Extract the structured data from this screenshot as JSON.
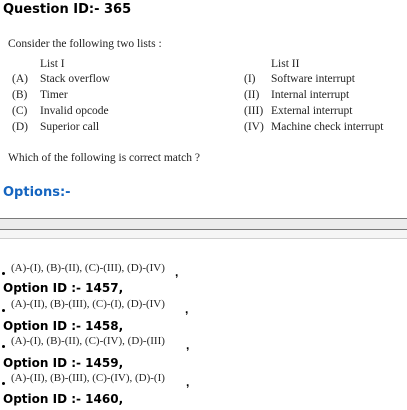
{
  "question": {
    "id_label": "Question ID:- 365",
    "statement": "Consider the following two lists :",
    "list1_title": "List I",
    "list2_title": "List II",
    "list1": [
      {
        "label": "(A)",
        "text": "Stack overflow"
      },
      {
        "label": "(B)",
        "text": "Timer"
      },
      {
        "label": "(C)",
        "text": "Invalid opcode"
      },
      {
        "label": "(D)",
        "text": "Superior call"
      }
    ],
    "list2": [
      {
        "label": "(I)",
        "text": "Software interrupt"
      },
      {
        "label": "(II)",
        "text": "Internal interrupt"
      },
      {
        "label": "(III)",
        "text": "External interrupt"
      },
      {
        "label": "(IV)",
        "text": "Machine check interrupt"
      }
    ],
    "prompt": "Which of the following is correct match ?"
  },
  "options_title": "Options:-",
  "options": [
    {
      "text": "(A)-(I), (B)-(II), (C)-(III), (D)-(IV)",
      "comma": ",",
      "id_label": "Option ID :- 1457,"
    },
    {
      "text": "(A)-(II), (B)-(III), (C)-(I), (D)-(IV)",
      "comma": ",",
      "id_label": "Option ID :- 1458,"
    },
    {
      "text": "(A)-(I), (B)-(II), (C)-(IV), (D)-(III)",
      "comma": ",",
      "id_label": "Option ID :- 1459,"
    },
    {
      "text": "(A)-(II), (B)-(III), (C)-(IV), (D)-(I)",
      "comma": ",",
      "id_label": "Option ID :- 1460,"
    }
  ]
}
